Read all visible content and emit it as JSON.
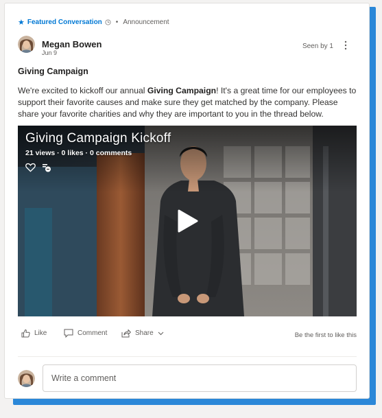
{
  "header": {
    "featured_label": "Featured Conversation",
    "separator": "•",
    "type_label": "Announcement"
  },
  "author": {
    "name": "Megan Bowen",
    "date": "Jun 9"
  },
  "seen": "Seen by 1",
  "post": {
    "title": "Giving Campaign",
    "body_pre": "We're excited to kickoff our annual ",
    "body_bold": "Giving Campaign",
    "body_post": "! It's a great time for our employees to support their favorite causes and make sure they get matched by the company. Please share your favorite charities and why they are important to you in the thread below."
  },
  "video": {
    "title": "Giving Campaign Kickoff",
    "stats": "21 views · 0 likes · 0 comments"
  },
  "actions": {
    "like": "Like",
    "comment": "Comment",
    "share": "Share",
    "first_like": "Be the first to like this"
  },
  "comment": {
    "placeholder": "Write a comment"
  },
  "colors": {
    "accent": "#0078d4",
    "shadow_bar": "#2b88d8"
  },
  "icons": [
    "star-icon",
    "clock-icon",
    "more-icon",
    "heart-icon",
    "closed-captions-icon",
    "play-icon",
    "like-icon",
    "comment-icon",
    "share-icon",
    "chevron-down-icon"
  ]
}
